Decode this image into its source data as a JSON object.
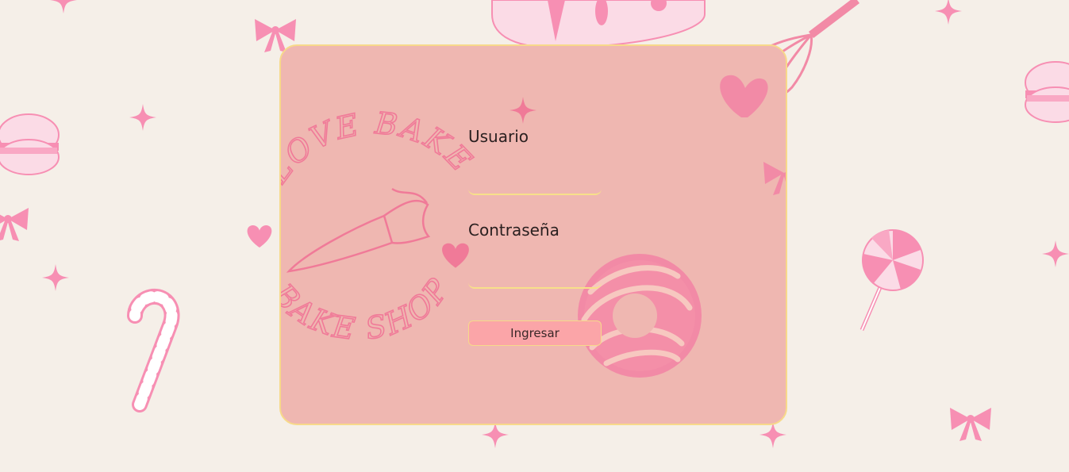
{
  "login": {
    "username_label": "Usuario",
    "username_value": "",
    "password_label": "Contraseña",
    "password_value": "",
    "submit_label": "Ingresar"
  },
  "logo": {
    "top_text": "LOVE BAKE",
    "bottom_text": "BAKE SHOP"
  },
  "icons": {
    "bow": "bow-icon",
    "sparkle": "sparkle-icon",
    "heart": "heart-icon",
    "macaron": "macaron-icon",
    "candy_cane": "candy-cane-icon",
    "lollipop": "lollipop-icon",
    "cake": "cake-icon",
    "whisk": "whisk-icon",
    "donut": "donut-icon",
    "piping_bag": "piping-bag-icon"
  },
  "colors": {
    "background": "#f5efe8",
    "card": "#efb7b1",
    "card_border": "#f7d98a",
    "accent_pink": "#f78fb3",
    "button": "#fba5a8"
  }
}
